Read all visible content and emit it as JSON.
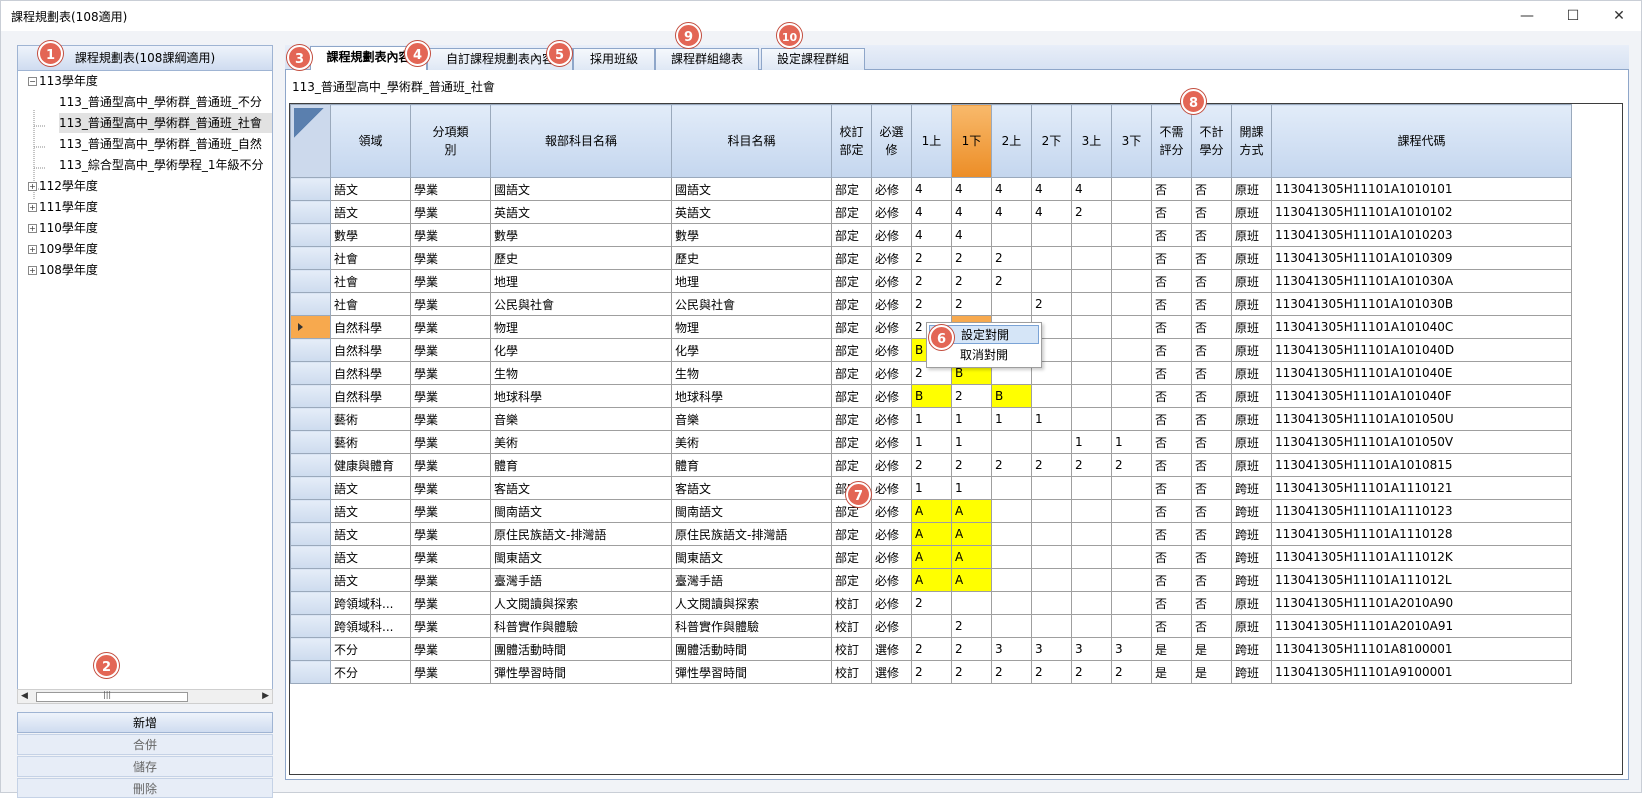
{
  "window": {
    "title": "課程規劃表(108適用)",
    "minimize": "—",
    "maximize": "☐",
    "close": "✕"
  },
  "left": {
    "header": "課程規劃表(108課綱適用)",
    "tree": [
      {
        "label": "113學年度",
        "toggle": "−"
      },
      {
        "label": "113_普通型高中_學術群_普通班_不分"
      },
      {
        "label": "113_普通型高中_學術群_普通班_社會"
      },
      {
        "label": "113_普通型高中_學術群_普通班_自然"
      },
      {
        "label": "113_綜合型高中_學術學程_1年級不分"
      },
      {
        "label": "112學年度",
        "toggle": "+"
      },
      {
        "label": "111學年度",
        "toggle": "+"
      },
      {
        "label": "110學年度",
        "toggle": "+"
      },
      {
        "label": "109學年度",
        "toggle": "+"
      },
      {
        "label": "108學年度",
        "toggle": "+"
      }
    ],
    "scroll_grip": "|||",
    "buttons": {
      "add": "新增",
      "merge": "合併",
      "save": "儲存",
      "delete": "刪除"
    }
  },
  "tabs": [
    "課程規劃表內容",
    "自訂課程規劃表內容",
    "採用班級",
    "課程群組總表",
    "設定課程群組"
  ],
  "path": "113_普通型高中_學術群_普通班_社會",
  "columns": [
    "領域",
    "分項類\n別",
    "報部科目名稱",
    "科目名稱",
    "校訂\n部定",
    "必選\n修",
    "1上",
    "1下",
    "2上",
    "2下",
    "3上",
    "3下",
    "不需\n評分",
    "不計\n學分",
    "開課\n方式",
    "課程代碼"
  ],
  "rows": [
    [
      "語文",
      "學業",
      "國語文",
      "國語文",
      "部定",
      "必修",
      "4",
      "4",
      "4",
      "4",
      "4",
      "",
      "否",
      "否",
      "原班",
      "113041305H11101A1010101"
    ],
    [
      "語文",
      "學業",
      "英語文",
      "英語文",
      "部定",
      "必修",
      "4",
      "4",
      "4",
      "4",
      "2",
      "",
      "否",
      "否",
      "原班",
      "113041305H11101A1010102"
    ],
    [
      "數學",
      "學業",
      "數學",
      "數學",
      "部定",
      "必修",
      "4",
      "4",
      "",
      "",
      "",
      "",
      "否",
      "否",
      "原班",
      "113041305H11101A1010203"
    ],
    [
      "社會",
      "學業",
      "歷史",
      "歷史",
      "部定",
      "必修",
      "2",
      "2",
      "2",
      "",
      "",
      "",
      "否",
      "否",
      "原班",
      "113041305H11101A1010309"
    ],
    [
      "社會",
      "學業",
      "地理",
      "地理",
      "部定",
      "必修",
      "2",
      "2",
      "2",
      "",
      "",
      "",
      "否",
      "否",
      "原班",
      "113041305H11101A101030A"
    ],
    [
      "社會",
      "學業",
      "公民與社會",
      "公民與社會",
      "部定",
      "必修",
      "2",
      "2",
      "",
      "2",
      "",
      "",
      "否",
      "否",
      "原班",
      "113041305H11101A101030B"
    ],
    [
      "自然科學",
      "學業",
      "物理",
      "物理",
      "部定",
      "必修",
      "2",
      "B",
      "",
      "",
      "",
      "",
      "否",
      "否",
      "原班",
      "113041305H11101A101040C"
    ],
    [
      "自然科學",
      "學業",
      "化學",
      "化學",
      "部定",
      "必修",
      "B",
      "2",
      "",
      "",
      "",
      "",
      "否",
      "否",
      "原班",
      "113041305H11101A101040D"
    ],
    [
      "自然科學",
      "學業",
      "生物",
      "生物",
      "部定",
      "必修",
      "2",
      "B",
      "",
      "",
      "",
      "",
      "否",
      "否",
      "原班",
      "113041305H11101A101040E"
    ],
    [
      "自然科學",
      "學業",
      "地球科學",
      "地球科學",
      "部定",
      "必修",
      "B",
      "2",
      "B",
      "",
      "",
      "",
      "否",
      "否",
      "原班",
      "113041305H11101A101040F"
    ],
    [
      "藝術",
      "學業",
      "音樂",
      "音樂",
      "部定",
      "必修",
      "1",
      "1",
      "1",
      "1",
      "",
      "",
      "否",
      "否",
      "原班",
      "113041305H11101A101050U"
    ],
    [
      "藝術",
      "學業",
      "美術",
      "美術",
      "部定",
      "必修",
      "1",
      "1",
      "",
      "",
      "1",
      "1",
      "否",
      "否",
      "原班",
      "113041305H11101A101050V"
    ],
    [
      "健康與體育",
      "學業",
      "體育",
      "體育",
      "部定",
      "必修",
      "2",
      "2",
      "2",
      "2",
      "2",
      "2",
      "否",
      "否",
      "原班",
      "113041305H11101A1010815"
    ],
    [
      "語文",
      "學業",
      "客語文",
      "客語文",
      "部定",
      "必修",
      "1",
      "1",
      "",
      "",
      "",
      "",
      "否",
      "否",
      "跨班",
      "113041305H11101A1110121"
    ],
    [
      "語文",
      "學業",
      "閩南語文",
      "閩南語文",
      "部定",
      "必修",
      "A",
      "A",
      "",
      "",
      "",
      "",
      "否",
      "否",
      "跨班",
      "113041305H11101A1110123"
    ],
    [
      "語文",
      "學業",
      "原住民族語文-排灣語",
      "原住民族語文-排灣語",
      "部定",
      "必修",
      "A",
      "A",
      "",
      "",
      "",
      "",
      "否",
      "否",
      "跨班",
      "113041305H11101A1110128"
    ],
    [
      "語文",
      "學業",
      "閩東語文",
      "閩東語文",
      "部定",
      "必修",
      "A",
      "A",
      "",
      "",
      "",
      "",
      "否",
      "否",
      "跨班",
      "113041305H11101A111012K"
    ],
    [
      "語文",
      "學業",
      "臺灣手語",
      "臺灣手語",
      "部定",
      "必修",
      "A",
      "A",
      "",
      "",
      "",
      "",
      "否",
      "否",
      "跨班",
      "113041305H11101A111012L"
    ],
    [
      "跨領域科...",
      "學業",
      "人文閱讀與探索",
      "人文閱讀與探索",
      "校訂",
      "必修",
      "2",
      "",
      "",
      "",
      "",
      "",
      "否",
      "否",
      "原班",
      "113041305H11101A2010A90"
    ],
    [
      "跨領域科...",
      "學業",
      "科普實作與體驗",
      "科普實作與體驗",
      "校訂",
      "必修",
      "",
      "2",
      "",
      "",
      "",
      "",
      "否",
      "否",
      "原班",
      "113041305H11101A2010A91"
    ],
    [
      "不分",
      "學業",
      "團體活動時間",
      "團體活動時間",
      "校訂",
      "選修",
      "2",
      "2",
      "3",
      "3",
      "3",
      "3",
      "是",
      "是",
      "跨班",
      "113041305H11101A8100001"
    ],
    [
      "不分",
      "學業",
      "彈性學習時間",
      "彈性學習時間",
      "校訂",
      "選修",
      "2",
      "2",
      "2",
      "2",
      "2",
      "2",
      "是",
      "是",
      "跨班",
      "113041305H11101A9100001"
    ]
  ],
  "context_menu": {
    "set_pair": "設定對開",
    "cancel_pair": "取消對開"
  },
  "badges": [
    "1",
    "2",
    "3",
    "4",
    "5",
    "6",
    "7",
    "8",
    "9",
    "10"
  ],
  "colors": {
    "highlight_yellow": "#ffff00",
    "selected_orange": "#f7a94e",
    "header_blue": "#c4d6ee",
    "badge_red": "#e36655"
  }
}
